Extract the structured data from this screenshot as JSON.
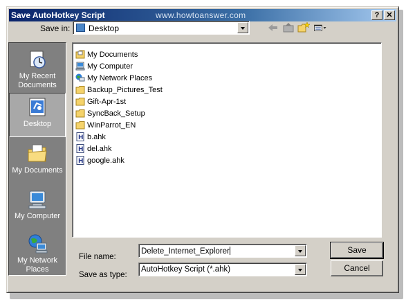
{
  "window": {
    "title": "Save AutoHotkey Script",
    "watermark": "www.howtoanswer.com",
    "help_glyph": "?",
    "close_glyph": "✕"
  },
  "save_in": {
    "label": "Save in:",
    "value": "Desktop",
    "icon": "desktop-icon"
  },
  "toolbar": {
    "items": [
      {
        "name": "back-icon"
      },
      {
        "name": "up-folder-icon"
      },
      {
        "name": "new-folder-icon"
      },
      {
        "name": "view-menu-icon"
      }
    ]
  },
  "places": [
    {
      "label": "My Recent Documents",
      "icon": "recent-documents-icon",
      "selected": false
    },
    {
      "label": "Desktop",
      "icon": "desktop-icon",
      "selected": true
    },
    {
      "label": "My Documents",
      "icon": "my-documents-icon",
      "selected": false
    },
    {
      "label": "My Computer",
      "icon": "my-computer-icon",
      "selected": false
    },
    {
      "label": "My Network Places",
      "icon": "network-places-icon",
      "selected": false
    }
  ],
  "files": [
    {
      "name": "My Documents",
      "icon": "my-documents-icon"
    },
    {
      "name": "My Computer",
      "icon": "my-computer-icon"
    },
    {
      "name": "My Network Places",
      "icon": "network-places-icon"
    },
    {
      "name": "Backup_Pictures_Test",
      "icon": "folder-icon"
    },
    {
      "name": "Gift-Apr-1st",
      "icon": "folder-icon"
    },
    {
      "name": "SyncBack_Setup",
      "icon": "folder-icon"
    },
    {
      "name": "WinParrot_EN",
      "icon": "folder-icon"
    },
    {
      "name": "b.ahk",
      "icon": "ahk-file-icon"
    },
    {
      "name": "del.ahk",
      "icon": "ahk-file-icon"
    },
    {
      "name": "google.ahk",
      "icon": "ahk-file-icon"
    }
  ],
  "file_name": {
    "label": "File name:",
    "value": "Delete_Internet_Explorer"
  },
  "save_as_type": {
    "label": "Save as type:",
    "value": "AutoHotkey Script (*.ahk)"
  },
  "buttons": {
    "save": "Save",
    "cancel": "Cancel"
  },
  "colors": {
    "titlebar_start": "#0a246a",
    "titlebar_end": "#a6caf0",
    "dialog_face": "#d4d0c8",
    "places_bar": "#808080",
    "folder": "#f5d36b"
  }
}
